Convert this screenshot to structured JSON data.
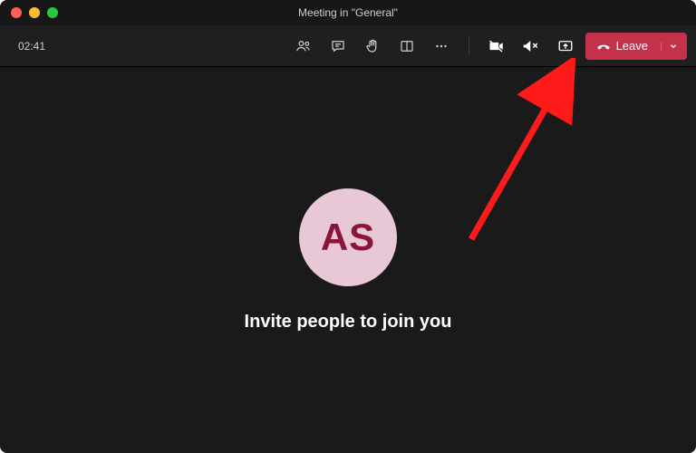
{
  "titlebar": {
    "title": "Meeting in \"General\""
  },
  "toolbar": {
    "timer": "02:41",
    "leave_label": "Leave"
  },
  "stage": {
    "avatar_initials": "AS",
    "invite_text": "Invite people to join you"
  }
}
